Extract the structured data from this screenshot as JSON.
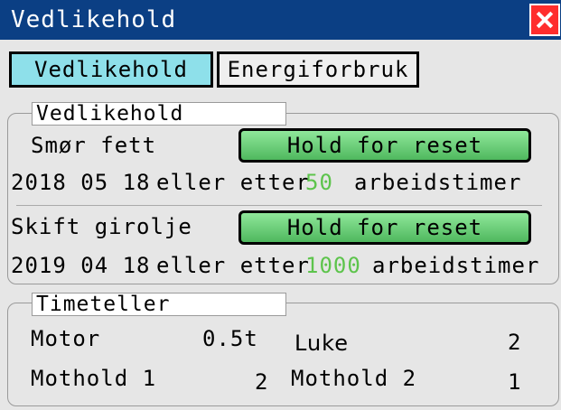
{
  "window": {
    "title": "Vedlikehold"
  },
  "tabs": [
    {
      "label": "Vedlikehold",
      "active": true
    },
    {
      "label": "Energiforbruk",
      "active": false
    }
  ],
  "maintenance": {
    "group_label": "Vedlikehold",
    "items": [
      {
        "label": "Smør fett",
        "button": "Hold for reset",
        "date": "2018 05 18",
        "or_after": "eller etter",
        "hours": "50",
        "unit": "arbeidstimer"
      },
      {
        "label": "Skift girolje",
        "button": "Hold for reset",
        "date": "2019 04 18",
        "or_after": "eller etter",
        "hours": "1000",
        "unit": "arbeidstimer"
      }
    ]
  },
  "counters": {
    "group_label": "Timeteller",
    "motor_label": "Motor",
    "motor_value": "0.5t",
    "hatch_label": "Luke",
    "hatch_value": "2",
    "counter1_label": "Mothold 1",
    "counter1_value": "2",
    "counter2_label": "Mothold 2",
    "counter2_value": "1"
  },
  "colors": {
    "titlebar": "#0b3f84",
    "tab_active": "#8ee0ea",
    "button_green": "#6fd27a",
    "hours_text": "#5dc44c",
    "close": "#ff2d2d"
  }
}
